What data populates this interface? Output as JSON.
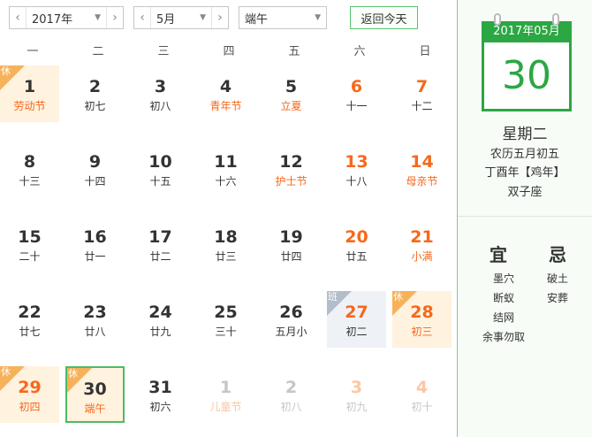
{
  "toolbar": {
    "year": "2017年",
    "month": "5月",
    "holiday": "端午",
    "today_button": "返回今天",
    "prev_arrow": "‹",
    "next_arrow": "›",
    "dropdown_arrow": "▼"
  },
  "weekdays": [
    "一",
    "二",
    "三",
    "四",
    "五",
    "六",
    "日"
  ],
  "days": [
    {
      "num": "1",
      "sub": "劳动节",
      "weekend": false,
      "festival": true,
      "tag": "休",
      "other": false,
      "today": false
    },
    {
      "num": "2",
      "sub": "初七",
      "weekend": false,
      "festival": false,
      "tag": "",
      "other": false,
      "today": false
    },
    {
      "num": "3",
      "sub": "初八",
      "weekend": false,
      "festival": false,
      "tag": "",
      "other": false,
      "today": false
    },
    {
      "num": "4",
      "sub": "青年节",
      "weekend": false,
      "festival": true,
      "tag": "",
      "other": false,
      "today": false
    },
    {
      "num": "5",
      "sub": "立夏",
      "weekend": false,
      "festival": true,
      "tag": "",
      "other": false,
      "today": false
    },
    {
      "num": "6",
      "sub": "十一",
      "weekend": true,
      "festival": false,
      "tag": "",
      "other": false,
      "today": false
    },
    {
      "num": "7",
      "sub": "十二",
      "weekend": true,
      "festival": false,
      "tag": "",
      "other": false,
      "today": false
    },
    {
      "num": "8",
      "sub": "十三",
      "weekend": false,
      "festival": false,
      "tag": "",
      "other": false,
      "today": false
    },
    {
      "num": "9",
      "sub": "十四",
      "weekend": false,
      "festival": false,
      "tag": "",
      "other": false,
      "today": false
    },
    {
      "num": "10",
      "sub": "十五",
      "weekend": false,
      "festival": false,
      "tag": "",
      "other": false,
      "today": false
    },
    {
      "num": "11",
      "sub": "十六",
      "weekend": false,
      "festival": false,
      "tag": "",
      "other": false,
      "today": false
    },
    {
      "num": "12",
      "sub": "护士节",
      "weekend": false,
      "festival": true,
      "tag": "",
      "other": false,
      "today": false
    },
    {
      "num": "13",
      "sub": "十八",
      "weekend": true,
      "festival": false,
      "tag": "",
      "other": false,
      "today": false
    },
    {
      "num": "14",
      "sub": "母亲节",
      "weekend": true,
      "festival": true,
      "tag": "",
      "other": false,
      "today": false
    },
    {
      "num": "15",
      "sub": "二十",
      "weekend": false,
      "festival": false,
      "tag": "",
      "other": false,
      "today": false
    },
    {
      "num": "16",
      "sub": "廿一",
      "weekend": false,
      "festival": false,
      "tag": "",
      "other": false,
      "today": false
    },
    {
      "num": "17",
      "sub": "廿二",
      "weekend": false,
      "festival": false,
      "tag": "",
      "other": false,
      "today": false
    },
    {
      "num": "18",
      "sub": "廿三",
      "weekend": false,
      "festival": false,
      "tag": "",
      "other": false,
      "today": false
    },
    {
      "num": "19",
      "sub": "廿四",
      "weekend": false,
      "festival": false,
      "tag": "",
      "other": false,
      "today": false
    },
    {
      "num": "20",
      "sub": "廿五",
      "weekend": true,
      "festival": false,
      "tag": "",
      "other": false,
      "today": false
    },
    {
      "num": "21",
      "sub": "小满",
      "weekend": true,
      "festival": true,
      "tag": "",
      "other": false,
      "today": false
    },
    {
      "num": "22",
      "sub": "廿七",
      "weekend": false,
      "festival": false,
      "tag": "",
      "other": false,
      "today": false
    },
    {
      "num": "23",
      "sub": "廿八",
      "weekend": false,
      "festival": false,
      "tag": "",
      "other": false,
      "today": false
    },
    {
      "num": "24",
      "sub": "廿九",
      "weekend": false,
      "festival": false,
      "tag": "",
      "other": false,
      "today": false
    },
    {
      "num": "25",
      "sub": "三十",
      "weekend": false,
      "festival": false,
      "tag": "",
      "other": false,
      "today": false
    },
    {
      "num": "26",
      "sub": "五月小",
      "weekend": false,
      "festival": false,
      "tag": "",
      "other": false,
      "today": false
    },
    {
      "num": "27",
      "sub": "初二",
      "weekend": true,
      "festival": false,
      "tag": "班",
      "other": false,
      "today": false
    },
    {
      "num": "28",
      "sub": "初三",
      "weekend": true,
      "festival": true,
      "tag": "休",
      "other": false,
      "today": false
    },
    {
      "num": "29",
      "sub": "初四",
      "weekend": true,
      "festival": true,
      "tag": "休",
      "other": false,
      "today": false
    },
    {
      "num": "30",
      "sub": "端午",
      "weekend": false,
      "festival": true,
      "tag": "休",
      "other": false,
      "today": true
    },
    {
      "num": "31",
      "sub": "初六",
      "weekend": false,
      "festival": false,
      "tag": "",
      "other": false,
      "today": false
    },
    {
      "num": "1",
      "sub": "儿童节",
      "weekend": false,
      "festival": true,
      "tag": "",
      "other": true,
      "today": false
    },
    {
      "num": "2",
      "sub": "初八",
      "weekend": false,
      "festival": false,
      "tag": "",
      "other": true,
      "today": false
    },
    {
      "num": "3",
      "sub": "初九",
      "weekend": true,
      "festival": false,
      "tag": "",
      "other": true,
      "today": false
    },
    {
      "num": "4",
      "sub": "初十",
      "weekend": true,
      "festival": false,
      "tag": "",
      "other": true,
      "today": false
    }
  ],
  "side": {
    "year_month": "2017年05月",
    "day": "30",
    "weekday": "星期二",
    "lunar": "农历五月初五",
    "ganzhi": "丁酉年【鸡年】",
    "zodiac": "双子座",
    "yi_title": "宜",
    "ji_title": "忌",
    "yi": [
      "墨穴",
      "断蚁",
      "结网",
      "余事勿取"
    ],
    "ji": [
      "破土",
      "安葬"
    ]
  },
  "colors": {
    "accent_green": "#2ba743",
    "weekend_orange": "#f7681b",
    "rest_bg": "#fff2df",
    "work_bg": "#eef1f6"
  }
}
